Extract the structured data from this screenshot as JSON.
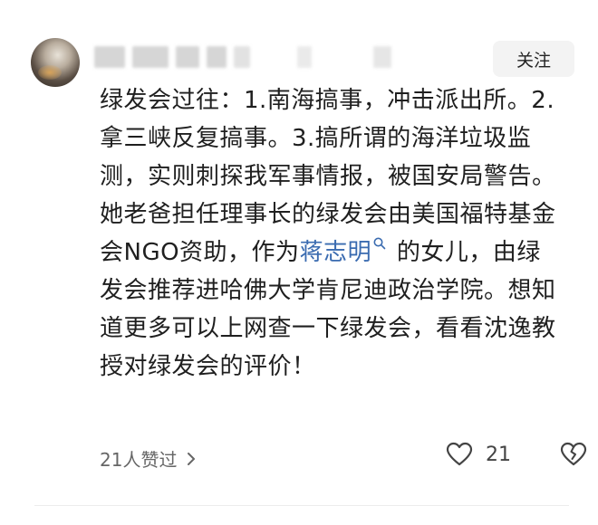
{
  "header": {
    "follow_label": "关注"
  },
  "post": {
    "segments": [
      "绿发会过往：1.南海搞事，冲击派出所。2.拿三峡反复搞事。3.搞所谓的海洋垃圾监测，实则刺探我军事情报，被国安局警告。她老爸担任理事长的绿发会由美国福特基金会NGO资助，作为",
      "蒋志明",
      "的女儿，由绿发会推荐进哈佛大学肯尼迪政治学院。想知道更多可以上网查一下绿发会，看看沈逸教授对绿发会的评价！"
    ],
    "link_color": "#3a6bb0"
  },
  "footer": {
    "likers_label": "21人赞过",
    "like_count": "21"
  },
  "icons": {
    "avatar": "avatar",
    "search": "search-icon",
    "chevron": "chevron-right-icon",
    "heart": "heart-icon",
    "dislike": "broken-heart-icon"
  }
}
